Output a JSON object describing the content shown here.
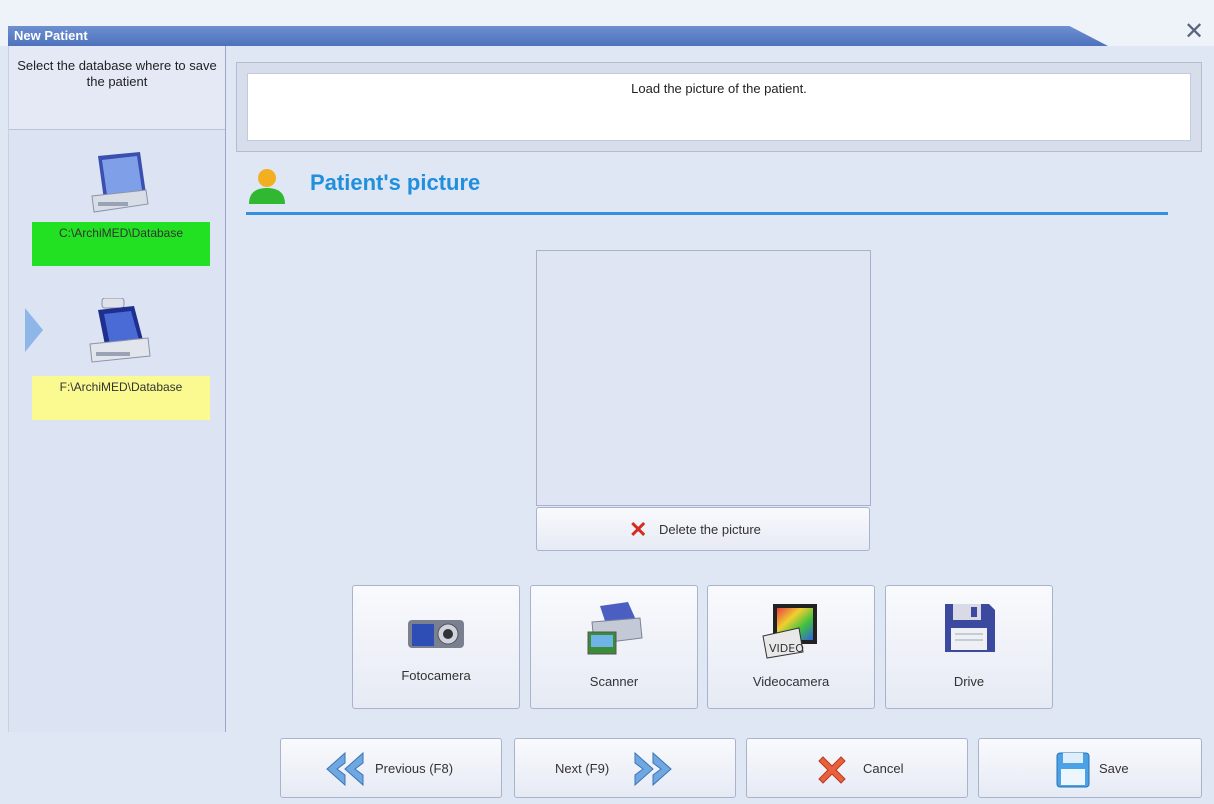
{
  "window": {
    "title": "New Patient"
  },
  "sidebar": {
    "heading": "Select the database where to save the patient",
    "databases": [
      {
        "path": "C:\\ArchiMED\\Database",
        "status_color": "#22e022",
        "icon": "hard-drive-icon",
        "selected": false
      },
      {
        "path": "F:\\ArchiMED\\Database",
        "status_color": "#fafa90",
        "icon": "removable-drive-icon",
        "selected": true
      }
    ]
  },
  "instruction": {
    "text": "Load the picture of the patient."
  },
  "section": {
    "title": "Patient's picture",
    "icon": "patient-icon",
    "accent": "#1f8fde"
  },
  "picture": {
    "delete_label": "Delete the picture"
  },
  "sources": [
    {
      "label": "Fotocamera",
      "icon": "camera-icon"
    },
    {
      "label": "Scanner",
      "icon": "scanner-icon"
    },
    {
      "label": "Videocamera",
      "icon": "video-icon"
    },
    {
      "label": "Drive",
      "icon": "floppy-icon"
    }
  ],
  "nav": {
    "previous": "Previous (F8)",
    "next": "Next (F9)",
    "cancel": "Cancel",
    "save": "Save"
  }
}
